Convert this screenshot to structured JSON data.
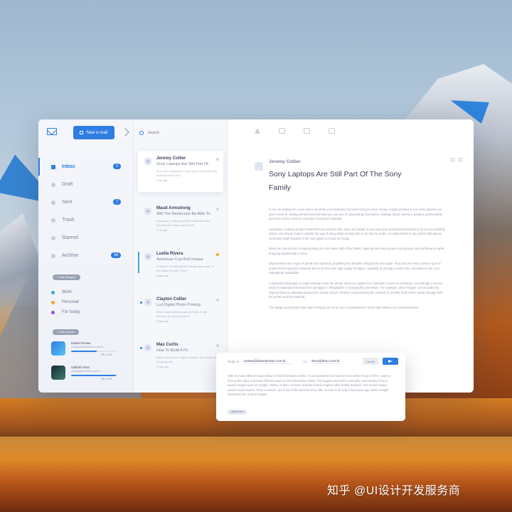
{
  "app": {
    "new_email_label": "New e-mail",
    "search_placeholder": "Search"
  },
  "colors": {
    "accent": "#2f7de1",
    "work": "#3aa8e8",
    "personal": "#f5a623",
    "today": "#9b51e0"
  },
  "sidebar": {
    "folders": [
      {
        "label": "Inbox",
        "count": "2",
        "icon": "inbox-icon"
      },
      {
        "label": "Draft",
        "count": "",
        "icon": "draft-icon"
      },
      {
        "label": "Sent",
        "count": "7",
        "icon": "sent-icon"
      },
      {
        "label": "Trash",
        "count": "",
        "icon": "trash-icon"
      },
      {
        "label": "Starred",
        "count": "",
        "icon": "star-icon"
      },
      {
        "label": "Archive",
        "count": "68",
        "icon": "archive-icon"
      }
    ],
    "add_category_label": "+ add category",
    "categories": [
      {
        "label": "Work"
      },
      {
        "label": "Personal"
      },
      {
        "label": "For today"
      }
    ],
    "add_account_label": "+ add account",
    "accounts": [
      {
        "name": "Daniel Snows",
        "email": "contact@danielsnows.com.br",
        "size": "MB of MB",
        "usage": 0.55
      },
      {
        "name": "Gabriel Ahoo",
        "email": "ahoo@gabrielahoo.com.br",
        "size": "MB of MB",
        "usage": 0.95
      }
    ]
  },
  "messages": [
    {
      "from": "Jeremy Collier",
      "subject": "Sony Laptops Are Still Part Of",
      "preview": "If you are looking for a new way to promote your business that won't",
      "date": "3 min ago"
    },
    {
      "from": "Maud Armstrong",
      "subject": "Will The Democrats Be Able To",
      "preview": "Nowadays, makeup printed materials have become fast, easy and simple",
      "date": "1 min ago"
    },
    {
      "from": "Luella Rivera",
      "subject": "Ameriicas Cup And Unique",
      "preview": "A number of \"differences\" things have been in the news recently. There",
      "date": "2 days ago"
    },
    {
      "from": "Clayton Collier",
      "subject": "Lcd Digital Photo Printing",
      "preview": "Since inkjet printing was invented, it has become an integral part of",
      "date": "5 days ago"
    },
    {
      "from": "Max Curtis",
      "subject": "How To Build A Pc",
      "preview": "Inkjet printers are a type of printer that works by dropping tiny",
      "date": "2 days ago"
    }
  ],
  "reader": {
    "from": "Jeremy Collier",
    "subject": "Sony Laptops Are Still Part Of The Sony Family",
    "paragraphs": [
      "If you are looking for a new way to promote your business that won't cost you more money, maybe printing is one of the options you won't resort to. Having printed materials that you can use for advertising, brochures, catalogs, flyers, banners, posters, and booklets are some of the common examples of printed materials.",
      "Nowadays, makeup printed materials have become fast, easy and simple. If you want your promotional material to be an eye-catching object, you should make it colorful. By way of using inkjet printing this is not hard to make. An inkjet printer is any printer that places extremely small droplets of ink onto paper to create an image.",
      "Since the introduction of inkjet printing in to the latter half of the 1980s, inkjet printers have grown in popularity and performance while dropping significantly in price.",
      "Inkjet printers are a type of printer that works by propelling tiny droplets of liquid ink onto paper. They are the most common type of printer for the general consumer due to its low cost, high quality of output, capability of printing in vivid color, and ease of use, and widespread availability.",
      "A particular advantage of inkjet printing is that the printer need not register the materials to have an enclosure. Accordingly, it can be used on materials that should be damaged in lithographic or xerographic processes. For example, direct images can be added by inkjet printing to materials produced in a base printer, whether compromising the material or another heat printer would damage both the printer and the material.",
      "The design and solution that inkjet Printing can do for you is unsurpassed. Some that makes your unconventional"
    ]
  },
  "reply": {
    "reply_to_label": "Reply to",
    "to": "contato@danielsnows.com.br",
    "cc_label": "Cc",
    "cc": "ahoo@ahoo.com.br",
    "cancel_label": "Cancel",
    "text": "With so many different ways today to find information online, it can sometimes be hard to know where to go to first. I want to look at the major and most effective ways to find information online. The biggest and most commonly used method is by a search engine such as Google, Yahoo, or Msn. All three of these search engines offer similar features. Two search image search social search. Point of search, are a few of the services they offer. It used to be only a few years ago where Google dominated the Search Engine",
    "attachment_label": "attachment"
  },
  "watermark": "知乎 @UI设计开发服务商"
}
